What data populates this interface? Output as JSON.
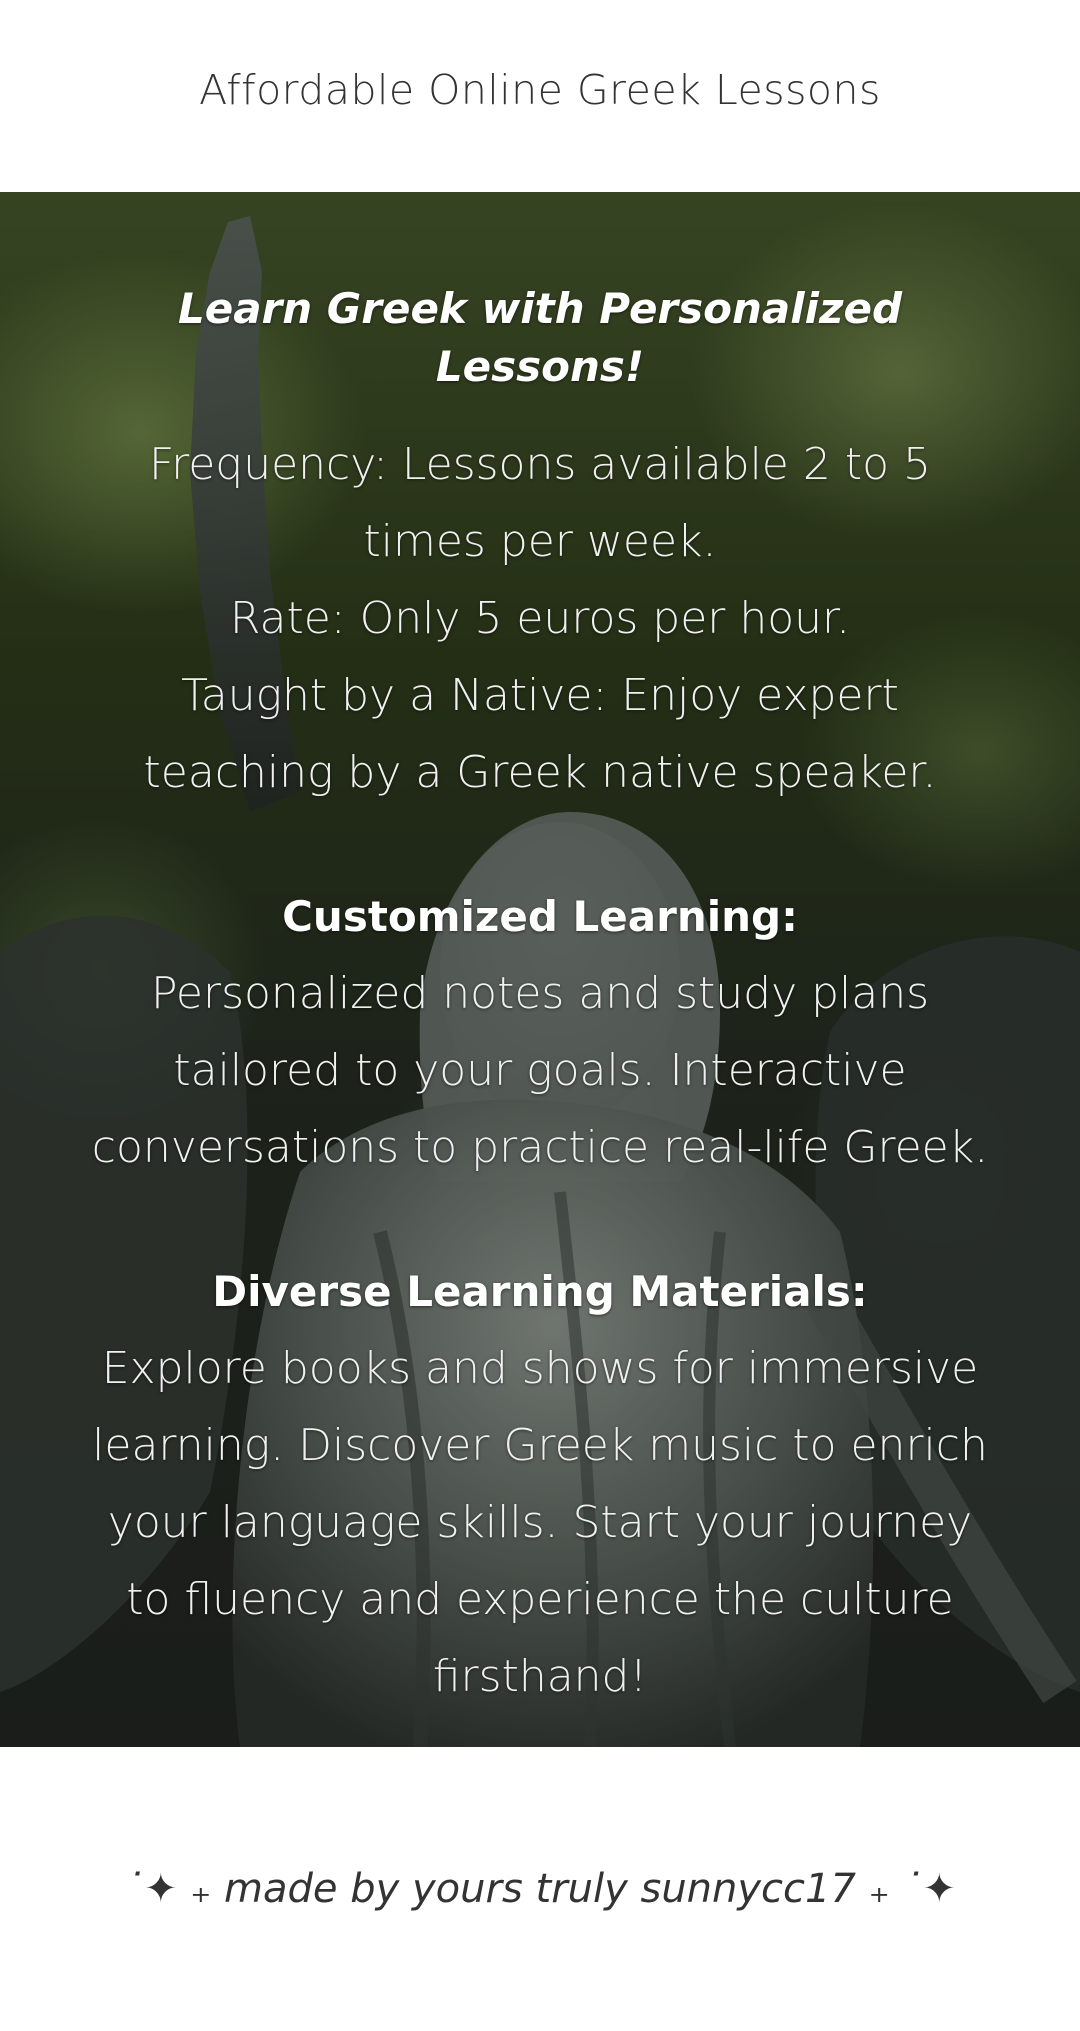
{
  "header": {
    "title": "Affordable Online Greek Lessons"
  },
  "hero": {
    "heading": "Learn Greek with Personalized Lessons!",
    "frequency": "Frequency: Lessons available 2 to 5 times per week.",
    "rate": "Rate: Only 5 euros per hour.",
    "native": "Taught by a Native: Enjoy expert teaching by a Greek native speaker.",
    "customized_heading": "Customized Learning:",
    "customized_text": "Personalized notes and study plans tailored to your goals. Interactive conversations to practice real-life Greek.",
    "materials_heading": "Diverse Learning Materials:",
    "materials_text": "Explore books and shows for immersive learning. Discover Greek music to enrich your language skills. Start your journey to fluency and experience the culture firsthand!"
  },
  "footer": {
    "credit": "˙✦ ₊ made by yours truly sunnycc17 ₊ ˙✦"
  },
  "colors": {
    "background": "#ffffff",
    "title_text": "#333333",
    "hero_text": "#f2f2f2"
  }
}
